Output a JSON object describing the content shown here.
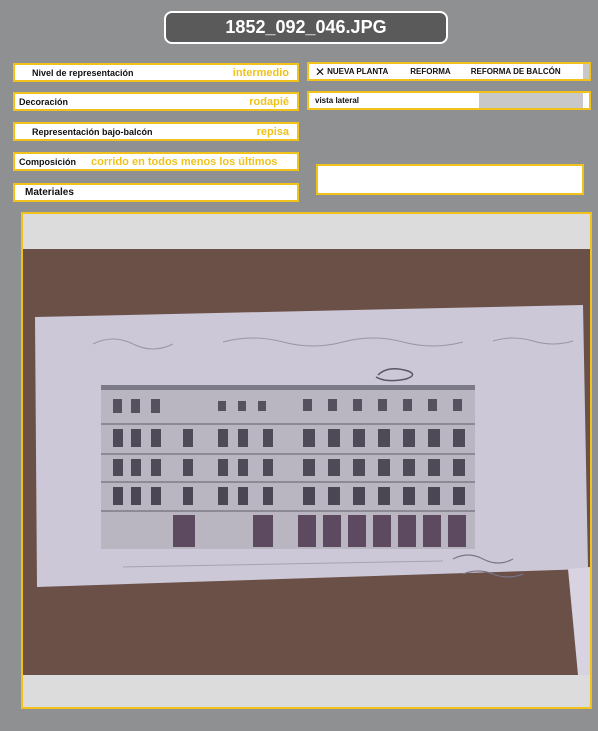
{
  "header": {
    "title": "1852_092_046.JPG"
  },
  "fields": {
    "nivel": {
      "label": "Nivel de representación",
      "value": "intermedio"
    },
    "decoracion": {
      "label": "Decoración",
      "value": "rodapié"
    },
    "bajo_balcon": {
      "label": "Representación bajo-balcón",
      "value": "repisa"
    },
    "composicion": {
      "label": "Composición",
      "value": "corrido en todos menos los últimos"
    },
    "materiales": {
      "label": "Materiales",
      "value": ""
    }
  },
  "tags": {
    "close_symbol": "✕",
    "items": [
      "NUEVA PLANTA",
      "REFORMA",
      "REFORMA DE  BALCÓN"
    ],
    "view": "vista lateral"
  },
  "colors": {
    "accent": "#f0c21b",
    "background": "#8f9092",
    "title_bg": "#5a5a5a"
  }
}
